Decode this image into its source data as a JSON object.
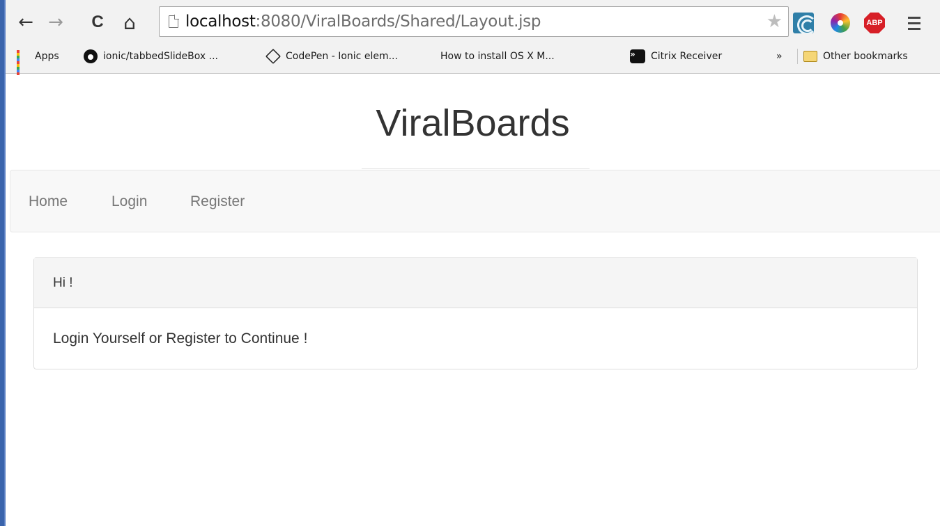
{
  "browser": {
    "back_glyph": "←",
    "forward_glyph": "→",
    "reload_glyph": "C",
    "home_glyph": "⌂",
    "url_host": "localhost",
    "url_path": ":8080/ViralBoards/Shared/Layout.jsp",
    "star_glyph": "★",
    "abp_label": "ABP",
    "icons": {
      "back": "arrow-left-icon",
      "forward": "arrow-right-icon",
      "reload": "reload-icon",
      "home": "home-icon",
      "page": "page-icon",
      "star": "star-icon",
      "extension1": "citrix-extension-icon",
      "extension2": "color-picker-icon",
      "extension3": "adblock-icon",
      "menu": "hamburger-menu-icon"
    }
  },
  "bookmarks": {
    "items": [
      {
        "label": "Apps",
        "icon": "apps-grid-icon"
      },
      {
        "label": "ionic/tabbedSlideBox ...",
        "icon": "github-icon"
      },
      {
        "label": "CodePen - Ionic elem...",
        "icon": "codepen-icon"
      },
      {
        "label": "How to install OS X M...",
        "icon": "apple-icon"
      },
      {
        "label": "Citrix Receiver",
        "icon": "citrix-icon"
      }
    ],
    "overflow": "»",
    "other": "Other bookmarks",
    "apple_glyph": "",
    "citrix_glyph": "»",
    "apps_colors": [
      "#ea4335",
      "#fbbc05",
      "#34a853",
      "#4285f4",
      "#ea4335",
      "#fbbc05",
      "#34a853",
      "#4285f4",
      "#ea4335"
    ]
  },
  "site": {
    "title": "ViralBoards"
  },
  "nav": {
    "home": "Home",
    "login": "Login",
    "register": "Register"
  },
  "panel": {
    "heading": "Hi !",
    "body": "Login Yourself or Register to Continue !"
  },
  "colors": {
    "title_text": "#333333",
    "nav_text": "#777777",
    "navbar_bg": "#f8f8f8",
    "panel_heading_bg": "#f5f5f5",
    "border": "#dddddd",
    "window_edge": "#3a64ac"
  }
}
